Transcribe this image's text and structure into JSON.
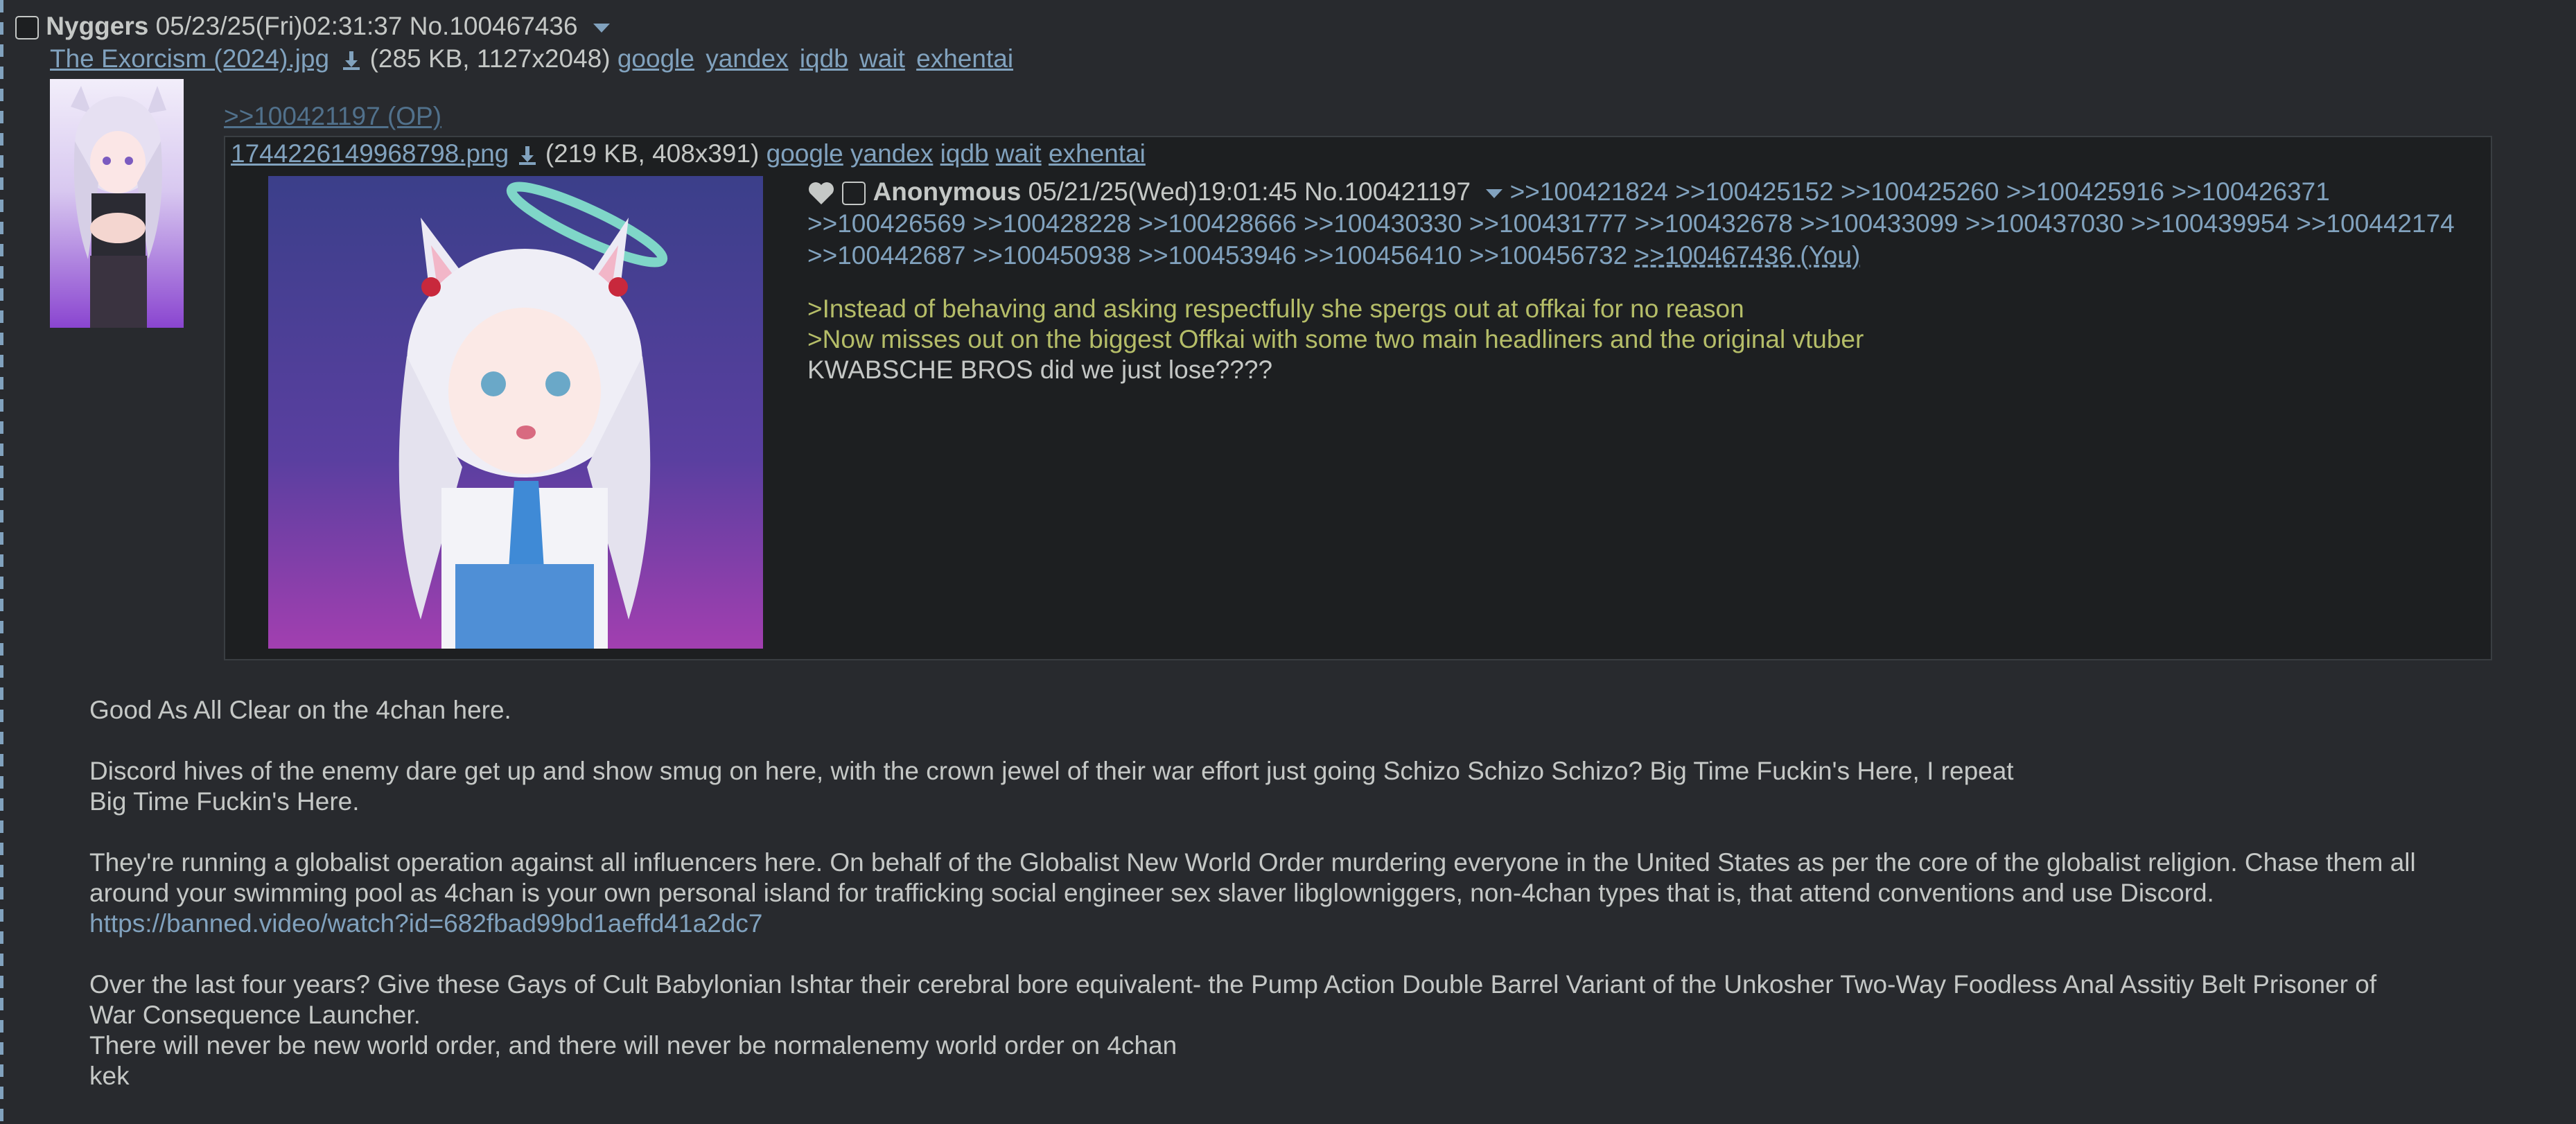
{
  "op": {
    "name": "Nyggers",
    "datetime": "05/23/25(Fri)02:31:37",
    "post_no": "No.100467436",
    "file": {
      "filename": "The Exorcism (2024).jpg",
      "info": "(285 KB, 1127x2048)",
      "search_links": [
        "google",
        "yandex",
        "iqdb",
        "wait",
        "exhentai"
      ]
    },
    "reply_to": ">>100421197 (OP)",
    "body_paragraphs": [
      [
        "Good As All Clear on the 4chan here."
      ],
      [
        "Discord hives of the enemy dare get up and show smug on here, with the crown jewel of their war effort just going Schizo Schizo Schizo? Big Time Fuckin's Here, I repeat",
        "Big Time Fuckin's Here."
      ],
      [
        "They're running a globalist operation against all influencers here. On behalf of the Globalist New World Order murdering everyone in the United States as per the core of the globalist religion. Chase them all",
        "around your swimming pool as 4chan is your own personal island for trafficking social engineer sex slaver libglowniggers, non-4chan types that is, that attend conventions and use Discord."
      ],
      [
        "Over the last four years? Give these Gays of Cult Babylonian Ishtar their cerebral bore equivalent- the Pump Action Double Barrel Variant of the Unkosher Two-Way Foodless Anal Assitiy Belt Prisoner of",
        "War Consequence Launcher.",
        "There will never be new world order, and there will never be normalenemy world order on 4chan",
        "kek"
      ]
    ],
    "body_link": "https://banned.video/watch?id=682fbad99bd1aeffd41a2dc7"
  },
  "inline_post": {
    "file": {
      "filename": "1744226149968798.png",
      "info": "(219 KB, 408x391)",
      "search_links": [
        "google",
        "yandex",
        "iqdb",
        "wait",
        "exhentai"
      ]
    },
    "name": "Anonymous",
    "datetime": "05/21/25(Wed)19:01:45",
    "post_no": "No.100421197",
    "quotelinks": [
      ">>100421824",
      ">>100425152",
      ">>100425260",
      ">>100425916",
      ">>100426371",
      ">>100426569",
      ">>100428228",
      ">>100428666",
      ">>100430330",
      ">>100431777",
      ">>100432678",
      ">>100433099",
      ">>100437030",
      ">>100439954",
      ">>100442174",
      ">>100442687",
      ">>100450938",
      ">>100453946",
      ">>100456410",
      ">>100456732"
    ],
    "you_link": ">>100467436 (You)",
    "greentext": [
      ">Instead of behaving and asking respectfully she spergs out at offkai for no reason",
      ">Now misses out on the biggest Offkai with some two main headliners and the original vtuber"
    ],
    "text": "KWABSCHE BROS did we just lose????"
  },
  "colors": {
    "background": "#282a2e",
    "inline_bg": "#1d1f21",
    "link": "#81a2be",
    "greentext": "#b5bd68",
    "text": "#c5c8c6"
  }
}
